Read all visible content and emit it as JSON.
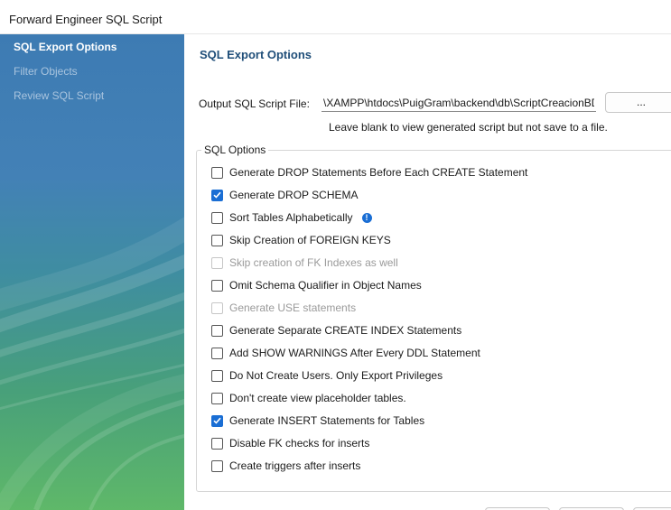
{
  "window": {
    "title": "Forward Engineer SQL Script"
  },
  "sidebar": {
    "items": [
      {
        "label": "SQL Export Options",
        "active": true
      },
      {
        "label": "Filter Objects",
        "active": false
      },
      {
        "label": "Review SQL Script",
        "active": false
      }
    ]
  },
  "main": {
    "title": "SQL Export Options",
    "output": {
      "label": "Output SQL Script File:",
      "value": "\\XAMPP\\htdocs\\PuigGram\\backend\\db\\ScriptCreacionBDNEW.sql",
      "browse_label": "...",
      "hint": "Leave blank to view generated script but not save to a file."
    },
    "options_group": {
      "legend": "SQL Options",
      "options": [
        {
          "label": "Generate DROP Statements Before Each CREATE Statement",
          "checked": false,
          "enabled": true
        },
        {
          "label": "Generate DROP SCHEMA",
          "checked": true,
          "enabled": true
        },
        {
          "label": "Sort Tables Alphabetically",
          "checked": false,
          "enabled": true
        },
        {
          "label": "Skip Creation of FOREIGN KEYS",
          "checked": false,
          "enabled": true
        },
        {
          "label": "Skip creation of FK Indexes as well",
          "checked": false,
          "enabled": false
        },
        {
          "label": "Omit Schema Qualifier in Object Names",
          "checked": false,
          "enabled": true
        },
        {
          "label": "Generate USE statements",
          "checked": false,
          "enabled": false
        },
        {
          "label": "Generate Separate CREATE INDEX Statements",
          "checked": false,
          "enabled": true
        },
        {
          "label": "Add SHOW WARNINGS After Every DDL Statement",
          "checked": false,
          "enabled": true
        },
        {
          "label": "Do Not Create Users. Only Export Privileges",
          "checked": false,
          "enabled": true
        },
        {
          "label": "Don't create view placeholder tables.",
          "checked": false,
          "enabled": true
        },
        {
          "label": "Generate INSERT Statements for Tables",
          "checked": true,
          "enabled": true
        },
        {
          "label": "Disable FK checks for inserts",
          "checked": false,
          "enabled": true
        },
        {
          "label": "Create triggers after inserts",
          "checked": false,
          "enabled": true
        }
      ]
    }
  },
  "colors": {
    "accent": "#1a6ed4",
    "title_text": "#1f4e79",
    "sidebar_top": "#3d7bb3",
    "sidebar_bottom": "#5fb869"
  },
  "icons": {
    "info": "info-icon",
    "check": "checkmark-icon"
  }
}
